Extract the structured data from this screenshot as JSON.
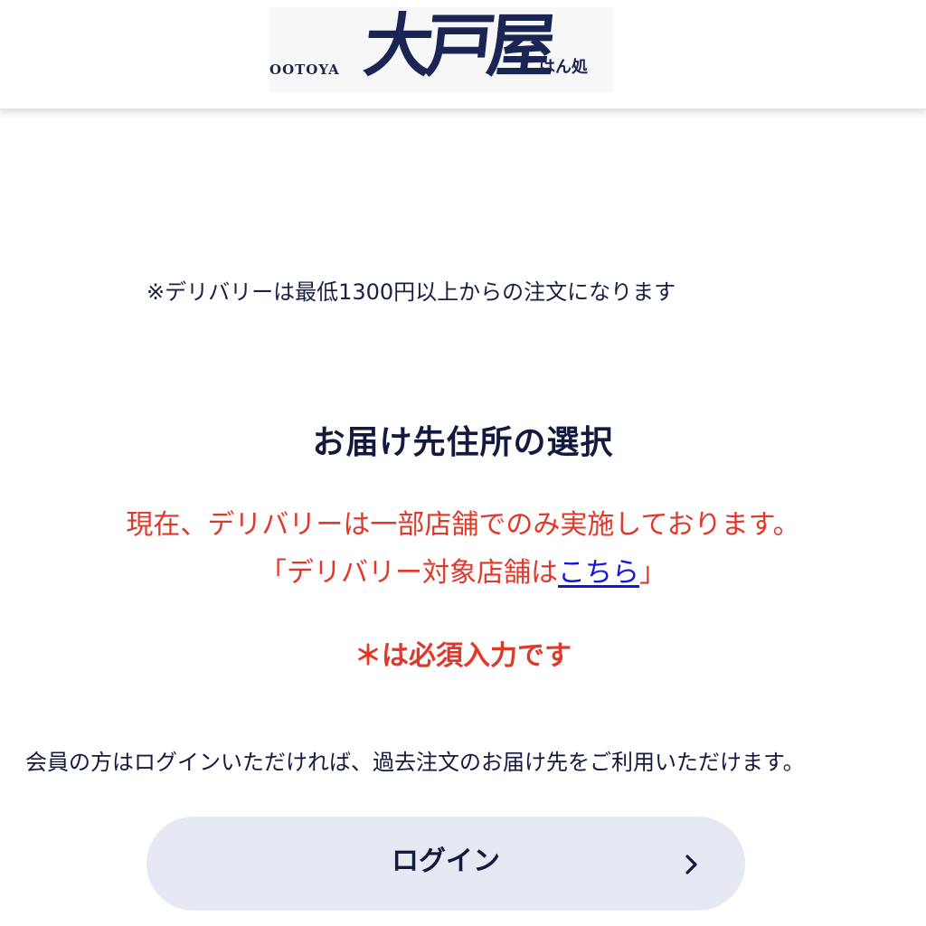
{
  "header": {
    "logo": {
      "latin": "OOTOYA",
      "kanji": "大戸屋",
      "sub": "ごはん処"
    }
  },
  "notices": {
    "minimum_order": "※デリバリーは最低1300円以上からの注文になります"
  },
  "main": {
    "title": "お届け先住所の選択",
    "red_line1": "現在、デリバリーは一部店舗でのみ実施しております。",
    "red_line2_prefix": "「デリバリー対象店舗は",
    "red_line2_link": "こちら",
    "red_line2_suffix": "」",
    "required_note": "＊は必須入力です",
    "member_note": "会員の方はログインいただければ、過去注文のお届け先をご利用いただけます。"
  },
  "login_button": {
    "label": "ログイン",
    "icon": "chevron-right-icon"
  },
  "colors": {
    "navy": "#14193e",
    "red": "#e0392b",
    "link": "#1414e8",
    "button_bg": "#e6e8f4"
  }
}
